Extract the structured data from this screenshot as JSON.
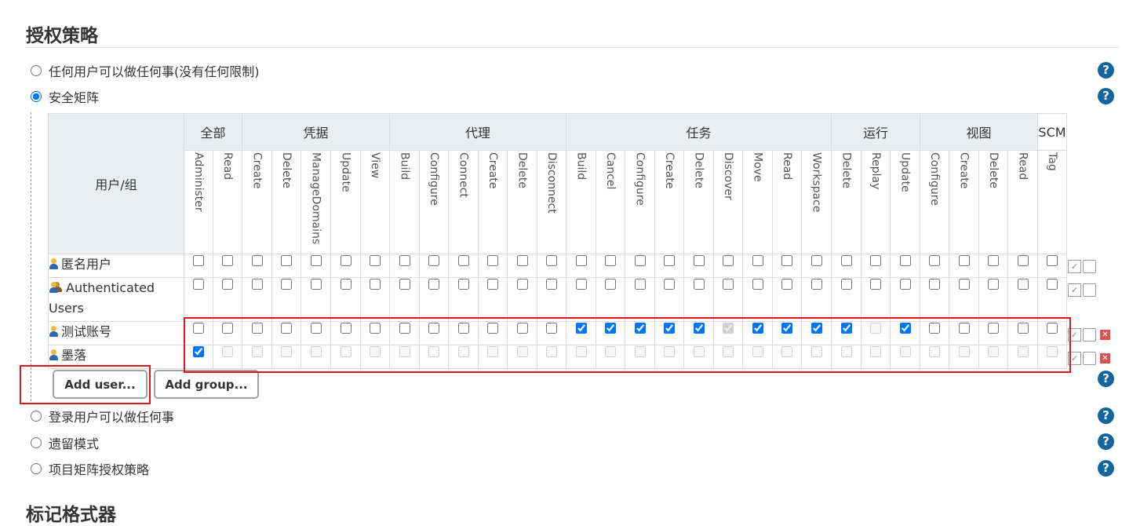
{
  "page": {
    "section_title": "授权策略",
    "next_section_title": "标记格式器",
    "help_glyph": "?"
  },
  "options": [
    {
      "label": "任何用户可以做任何事(没有任何限制)",
      "selected": false
    },
    {
      "label": "安全矩阵",
      "selected": true
    },
    {
      "label": "登录用户可以做任何事",
      "selected": false
    },
    {
      "label": "遗留模式",
      "selected": false
    },
    {
      "label": "项目矩阵授权策略",
      "selected": false
    }
  ],
  "matrix": {
    "corner_label": "用户/组",
    "groups": [
      {
        "name": "全部",
        "span": 2
      },
      {
        "name": "凭据",
        "span": 5
      },
      {
        "name": "代理",
        "span": 6
      },
      {
        "name": "任务",
        "span": 9
      },
      {
        "name": "运行",
        "span": 3
      },
      {
        "name": "视图",
        "span": 4
      },
      {
        "name": "SCM",
        "span": 1
      }
    ],
    "permissions": [
      "Administer",
      "Read",
      "Create",
      "Delete",
      "ManageDomains",
      "Update",
      "View",
      "Build",
      "Configure",
      "Connect",
      "Create",
      "Delete",
      "Disconnect",
      "Build",
      "Cancel",
      "Configure",
      "Create",
      "Delete",
      "Discover",
      "Move",
      "Read",
      "Workspace",
      "Delete",
      "Replay",
      "Update",
      "Configure",
      "Create",
      "Delete",
      "Read",
      "Tag"
    ],
    "rows": [
      {
        "name": "匿名用户",
        "icon": "user-icon",
        "checked": [],
        "disabled": [],
        "deletable": false
      },
      {
        "name": "Authenticated Users",
        "icon": "group-icon",
        "checked": [],
        "disabled": [],
        "deletable": false
      },
      {
        "name": "测试账号",
        "icon": "user-icon",
        "checked": [
          13,
          14,
          15,
          16,
          17,
          18,
          19,
          20,
          21,
          22,
          24
        ],
        "disabled": [
          18,
          23
        ],
        "deletable": true
      },
      {
        "name": "墨落",
        "icon": "user-icon",
        "checked": [
          0
        ],
        "disabled": "all-except-0",
        "deletable": true
      }
    ]
  },
  "buttons": {
    "add_user": "Add user...",
    "add_group": "Add group..."
  },
  "colors": {
    "highlight_box": "#e3141b",
    "help_icon": "#14649e",
    "header_bg": "#ebeef1"
  }
}
